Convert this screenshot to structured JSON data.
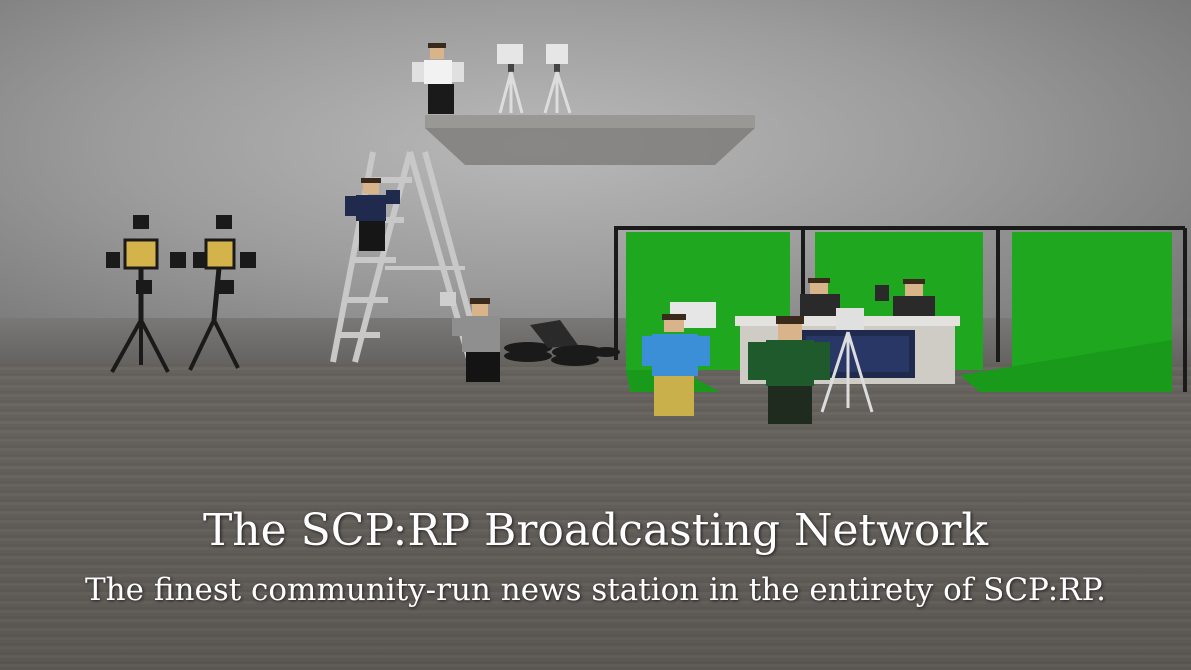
{
  "caption": {
    "title": "The SCP:RP Broadcasting Network",
    "subtitle": "The finest community-run news station in the entirety of SCP:RP."
  },
  "colors": {
    "green_screen": "#1fa81f",
    "wall": "#a8a8a8",
    "floor": "#6e6a66",
    "caption_text": "#ffffff"
  }
}
